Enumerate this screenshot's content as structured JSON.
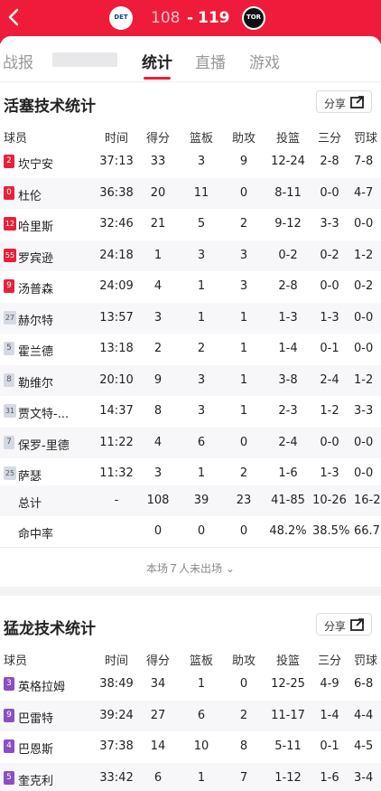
{
  "header": {
    "back_icon": "chevron-left-icon",
    "away_logo": "DET",
    "home_logo": "TOR",
    "away_score": "108",
    "separator": "-",
    "home_score": "119"
  },
  "tabs": [
    {
      "label": "战报"
    },
    {
      "label": "统计"
    },
    {
      "label": "直播"
    },
    {
      "label": "游戏"
    }
  ],
  "detroit": {
    "title": "活塞技术统计",
    "share_label": "分享",
    "columns": [
      "球员",
      "时间",
      "得分",
      "篮板",
      "助攻",
      "投篮",
      "三分",
      "罚球"
    ],
    "players": [
      {
        "num": "2",
        "name": "坎宁安",
        "min": "37:13",
        "pts": "33",
        "reb": "3",
        "ast": "9",
        "fg": "12-24",
        "tp": "2-8",
        "ft": "7-8",
        "starter": true
      },
      {
        "num": "0",
        "name": "杜伦",
        "min": "36:38",
        "pts": "20",
        "reb": "11",
        "ast": "0",
        "fg": "8-11",
        "tp": "0-0",
        "ft": "4-7",
        "starter": true
      },
      {
        "num": "12",
        "name": "哈里斯",
        "min": "32:46",
        "pts": "21",
        "reb": "5",
        "ast": "2",
        "fg": "9-12",
        "tp": "3-3",
        "ft": "0-0",
        "starter": true
      },
      {
        "num": "55",
        "name": "罗宾逊",
        "min": "24:18",
        "pts": "1",
        "reb": "3",
        "ast": "3",
        "fg": "0-2",
        "tp": "0-2",
        "ft": "1-2",
        "starter": true
      },
      {
        "num": "9",
        "name": "汤普森",
        "min": "24:09",
        "pts": "4",
        "reb": "1",
        "ast": "3",
        "fg": "2-8",
        "tp": "0-0",
        "ft": "0-2",
        "starter": true
      },
      {
        "num": "27",
        "name": "赫尔特",
        "min": "13:57",
        "pts": "3",
        "reb": "1",
        "ast": "1",
        "fg": "1-3",
        "tp": "1-3",
        "ft": "0-0",
        "starter": false
      },
      {
        "num": "5",
        "name": "霍兰德",
        "min": "13:18",
        "pts": "2",
        "reb": "2",
        "ast": "1",
        "fg": "1-4",
        "tp": "0-1",
        "ft": "0-0",
        "starter": false
      },
      {
        "num": "8",
        "name": "勒维尔",
        "min": "20:10",
        "pts": "9",
        "reb": "3",
        "ast": "1",
        "fg": "3-8",
        "tp": "2-4",
        "ft": "1-2",
        "starter": false
      },
      {
        "num": "31",
        "name": "贾文特-...",
        "min": "14:37",
        "pts": "8",
        "reb": "3",
        "ast": "1",
        "fg": "2-3",
        "tp": "1-2",
        "ft": "3-3",
        "starter": false
      },
      {
        "num": "7",
        "name": "保罗-里德",
        "min": "11:22",
        "pts": "4",
        "reb": "6",
        "ast": "0",
        "fg": "2-4",
        "tp": "0-0",
        "ft": "0-0",
        "starter": false
      },
      {
        "num": "25",
        "name": "萨瑟",
        "min": "11:32",
        "pts": "3",
        "reb": "1",
        "ast": "2",
        "fg": "1-6",
        "tp": "1-3",
        "ft": "0-0",
        "starter": false
      }
    ],
    "total": {
      "label": "总计",
      "min": "-",
      "pts": "108",
      "reb": "39",
      "ast": "23",
      "fg": "41-85",
      "tp": "10-26",
      "ft": "16-2"
    },
    "pct": {
      "label": "命中率",
      "pts": "0",
      "reb": "0",
      "ast": "0",
      "fg": "48.2%",
      "tp": "38.5%",
      "ft": "66.7"
    },
    "dnp": "本场７人未出场"
  },
  "toronto": {
    "title": "猛龙技术统计",
    "share_label": "分享",
    "columns": [
      "球员",
      "时间",
      "得分",
      "篮板",
      "助攻",
      "投篮",
      "三分",
      "罚球"
    ],
    "players": [
      {
        "num": "3",
        "name": "英格拉姆",
        "min": "38:49",
        "pts": "34",
        "reb": "1",
        "ast": "0",
        "fg": "12-25",
        "tp": "4-9",
        "ft": "6-8",
        "starter": true
      },
      {
        "num": "9",
        "name": "巴雷特",
        "min": "39:24",
        "pts": "27",
        "reb": "6",
        "ast": "2",
        "fg": "11-17",
        "tp": "1-4",
        "ft": "4-4",
        "starter": true
      },
      {
        "num": "4",
        "name": "巴恩斯",
        "min": "37:38",
        "pts": "14",
        "reb": "10",
        "ast": "8",
        "fg": "5-11",
        "tp": "0-1",
        "ft": "4-5",
        "starter": true
      },
      {
        "num": "5",
        "name": "奎克利",
        "min": "33:42",
        "pts": "6",
        "reb": "1",
        "ast": "7",
        "fg": "1-12",
        "tp": "1-6",
        "ft": "3-4",
        "starter": true
      }
    ]
  },
  "colors": {
    "brand_red": "#ee1c3a",
    "raptors_purple": "#8a4fc3"
  }
}
